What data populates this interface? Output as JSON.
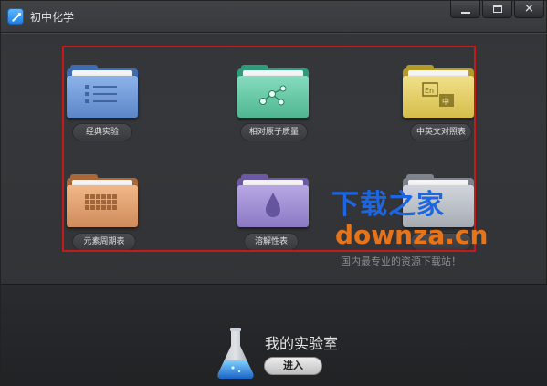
{
  "window": {
    "title": "初中化学",
    "controls": {
      "minimize": "—",
      "maximize": "□",
      "close": "✕"
    }
  },
  "modules": [
    {
      "label": "经典实验",
      "icon": "list-icon",
      "color": "#6c97d6"
    },
    {
      "label": "相对原子质量",
      "icon": "molecule-icon",
      "color": "#5fc4a4"
    },
    {
      "label": "中英文对照表",
      "icon": "translate-icon",
      "color": "#e2c94e"
    },
    {
      "label": "元素周期表",
      "icon": "periodic-table-icon",
      "color": "#d89a62"
    },
    {
      "label": "溶解性表",
      "icon": "droplet-icon",
      "color": "#9886cc"
    },
    {
      "label": "",
      "icon": "folder-icon",
      "color": "#b9bdc4"
    }
  ],
  "watermark": {
    "brand_zh": "下载之家",
    "brand_en": "downza.cn",
    "tagline": "国内最专业的资源下载站！"
  },
  "lab": {
    "title": "我的实验室",
    "enter_label": "进入"
  }
}
